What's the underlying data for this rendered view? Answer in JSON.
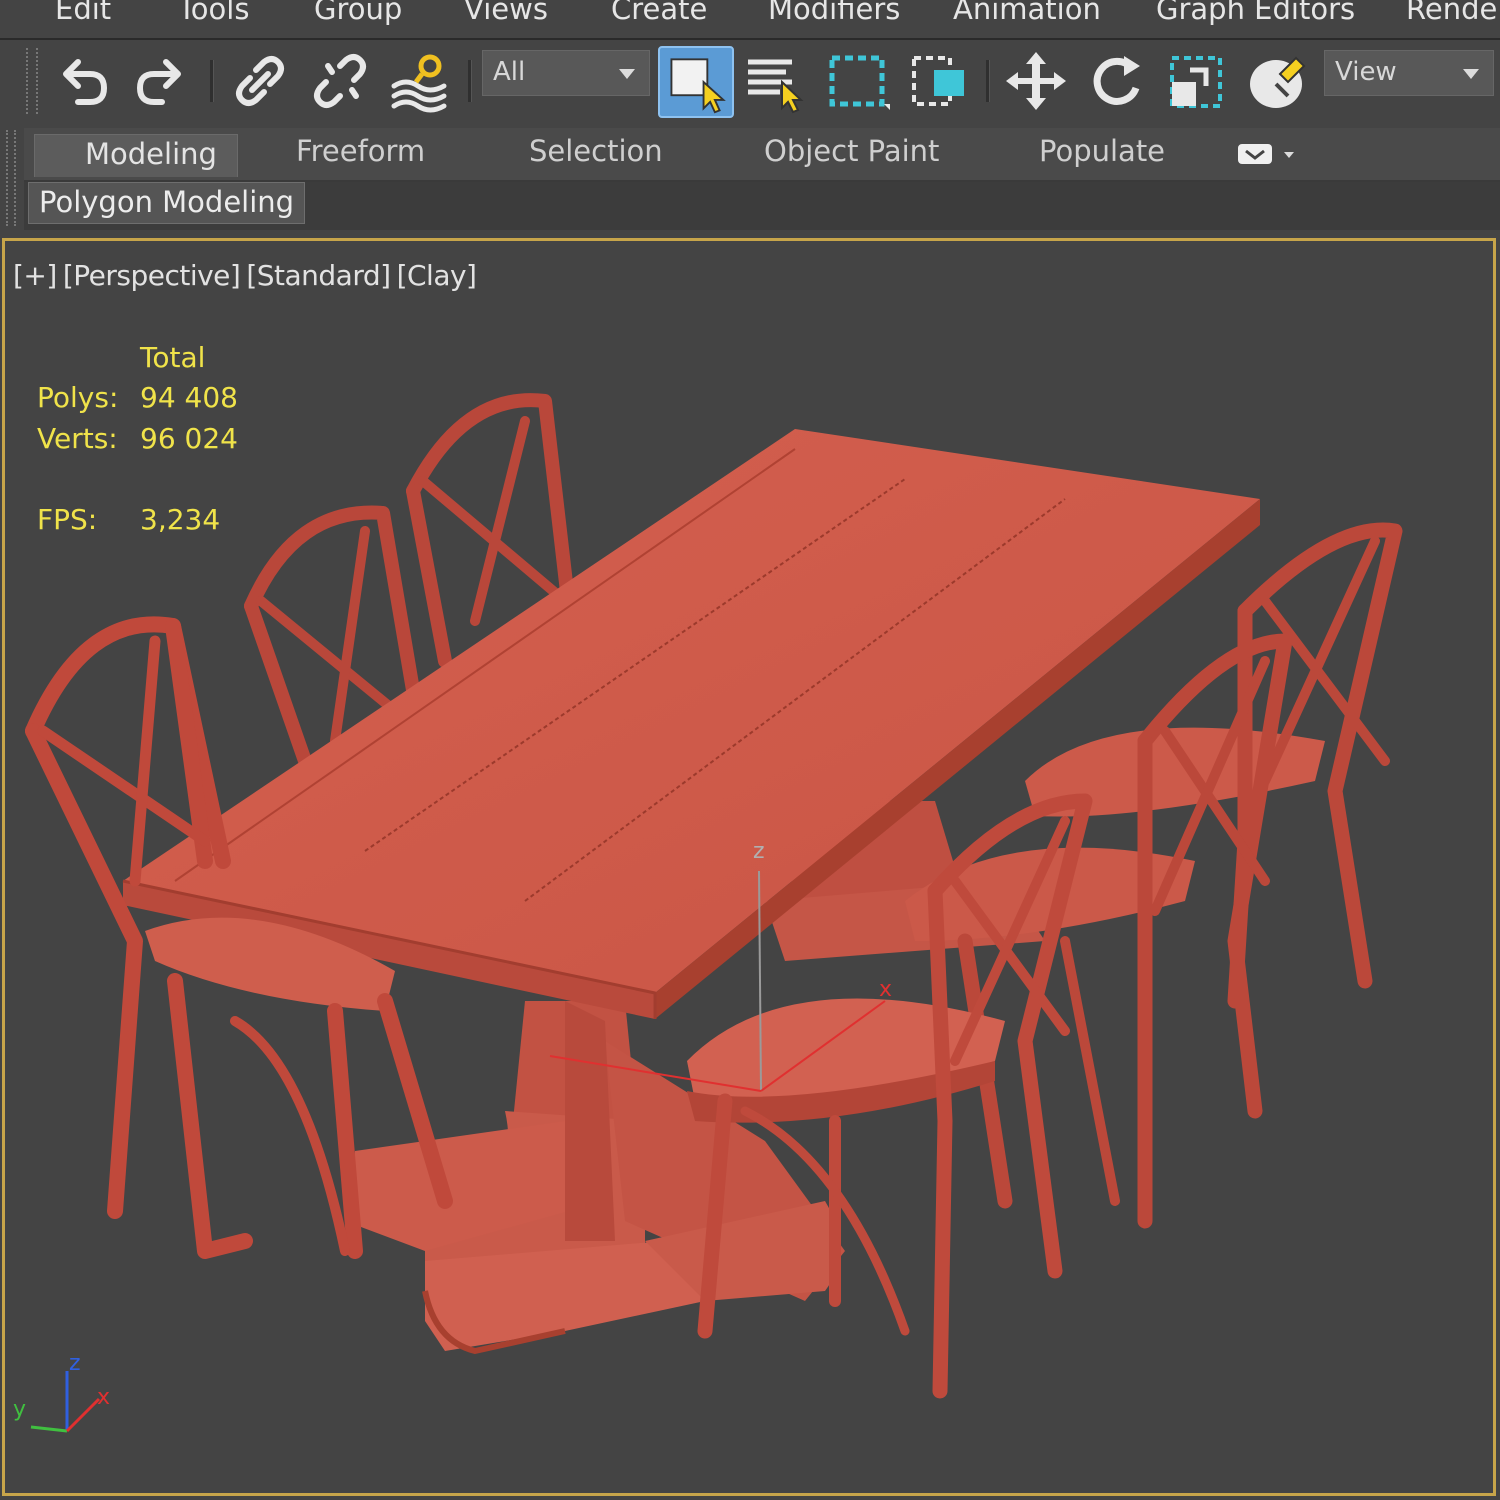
{
  "menu": [
    "Edit",
    "Tools",
    "Group",
    "Views",
    "Create",
    "Modifiers",
    "Animation",
    "Graph Editors",
    "Render"
  ],
  "toolbar": {
    "selection_filter": "All",
    "reference_coord": "View",
    "icons": [
      "undo-icon",
      "redo-icon",
      "link-icon",
      "unlink-icon",
      "bind-space-warp-icon",
      "select-object-icon",
      "select-by-name-icon",
      "rectangular-selection-icon",
      "window-crossing-icon",
      "move-icon",
      "rotate-icon",
      "scale-icon",
      "placement-icon"
    ]
  },
  "ribbon": {
    "tabs": [
      "Modeling",
      "Freeform",
      "Selection",
      "Object Paint",
      "Populate"
    ],
    "active_tab": "Modeling",
    "panel": "Polygon Modeling"
  },
  "viewport": {
    "labels": [
      "[+]",
      "[Perspective]",
      "[Standard]",
      "[Clay]"
    ],
    "stats": {
      "header": "Total",
      "polys_label": "Polys:",
      "polys_value": "94 408",
      "verts_label": "Verts:",
      "verts_value": "96 024",
      "fps_label": "FPS:",
      "fps_value": "3,234"
    },
    "gizmo_axes": {
      "z": "z",
      "x": "x"
    },
    "tripod": {
      "z": "z",
      "y": "y",
      "x": "x"
    }
  },
  "colors": {
    "background": "#444444",
    "active_viewport_border": "#c7a54a",
    "stats_text": "#f0e34a",
    "clay": "#cf5a4a",
    "selection_highlight": "#5b9bd5"
  }
}
